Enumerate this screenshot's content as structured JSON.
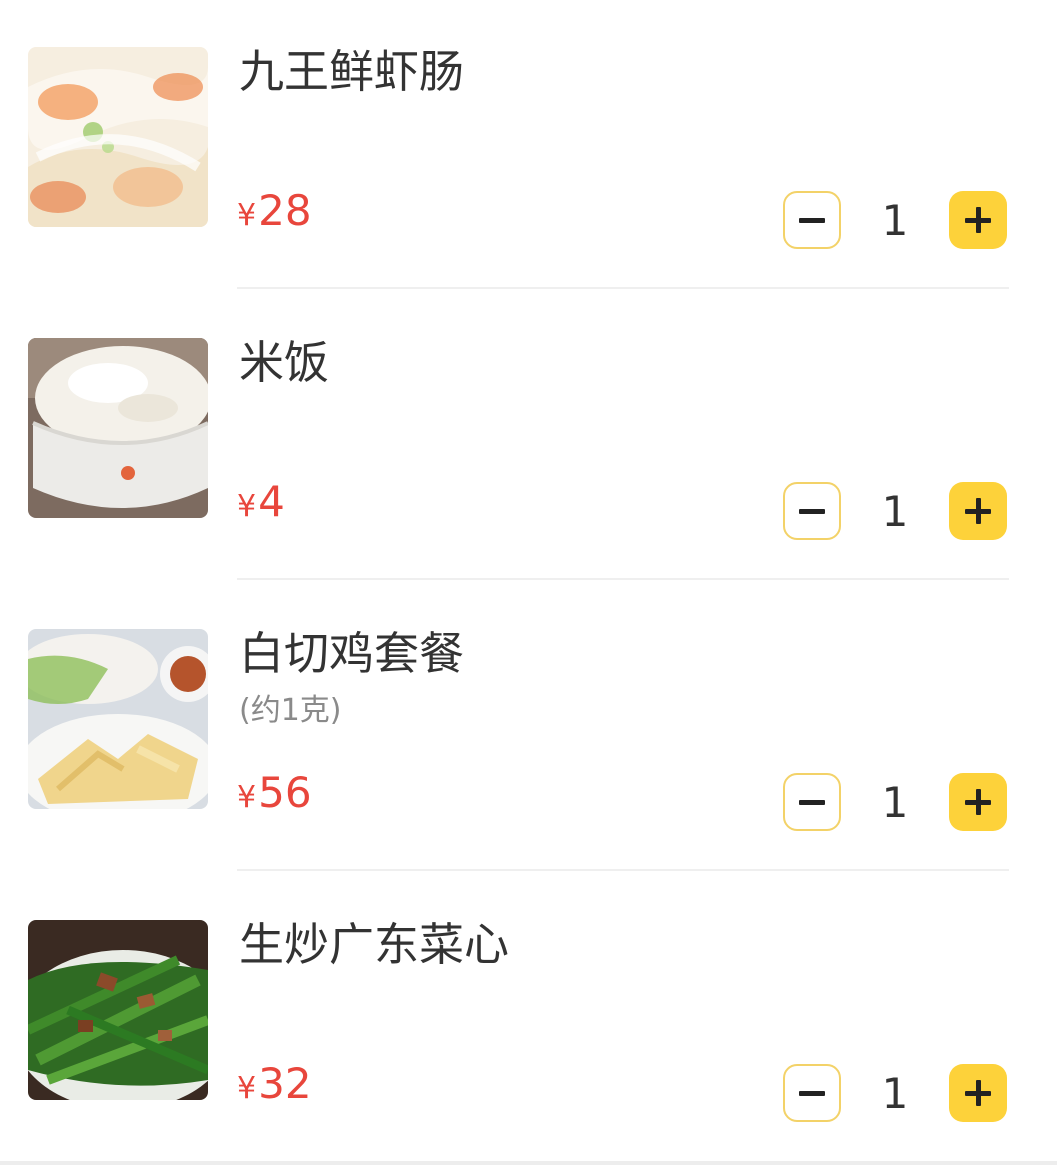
{
  "items": [
    {
      "name": "九王鲜虾肠",
      "spec": "",
      "currency": "¥",
      "price": "28",
      "quantity": "1",
      "image": "shrimp-rice-roll-photo"
    },
    {
      "name": "米饭",
      "spec": "",
      "currency": "¥",
      "price": "4",
      "quantity": "1",
      "image": "rice-bowl-photo"
    },
    {
      "name": "白切鸡套餐",
      "spec": "(约1克)",
      "currency": "¥",
      "price": "56",
      "quantity": "1",
      "image": "white-cut-chicken-photo"
    },
    {
      "name": "生炒广东菜心",
      "spec": "",
      "currency": "¥",
      "price": "32",
      "quantity": "1",
      "image": "stir-fried-choy-sum-photo"
    }
  ],
  "colors": {
    "price": "#e8463c",
    "plus_button": "#fdd23a",
    "minus_border": "#f3d268"
  }
}
